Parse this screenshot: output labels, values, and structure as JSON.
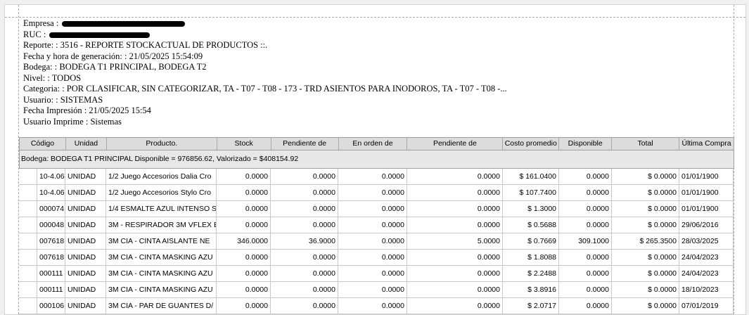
{
  "report": {
    "empresa_label": "Empresa :",
    "ruc_label": "RUC :",
    "reporte": "Reporte:  : 3516 - REPORTE STOCKACTUAL DE PRODUCTOS ::.",
    "fecha_generacion": "Fecha y hora de generación:  : 21/05/2025 15:54:09",
    "bodega": "Bodega:  : BODEGA T1  PRINCIPAL, BODEGA T2",
    "nivel": "Nivel:  : TODOS",
    "categoria": "Categoria:  : POR CLASIFICAR, SIN CATEGORIZAR, TA - T07 - T08 - 173 - TRD ASIENTOS PARA INODOROS, TA - T07 - T08 -...",
    "usuario": "Usuario:  : SISTEMAS",
    "fecha_impresion": "Fecha Impresión : 21/05/2025 15:54",
    "usuario_imprime": "Usuario Imprime : Sistemas"
  },
  "table": {
    "headers": [
      "Código",
      "Unidad",
      "Producto.",
      "Stock",
      "Pendiente de",
      "En orden de",
      "Pendiente de",
      "Costo promedio",
      "Disponible",
      "Total",
      "Última Compra"
    ],
    "group_label": "Bodega: BODEGA T1 PRINCIPAL Disponible = 976856.62, Valorizado = $408154.92",
    "rows": [
      [
        "10-4.06",
        "UNIDAD",
        "1/2 Juego Accesorios Dalia Cro",
        "0.0000",
        "0.0000",
        "0.0000",
        "0.0000",
        "$ 161.0400",
        "0.0000",
        "$ 0.0000",
        "01/01/1900"
      ],
      [
        "10-4.06",
        "UNIDAD",
        "1/2 Juego Accesorios Stylo Cro",
        "0.0000",
        "0.0000",
        "0.0000",
        "0.0000",
        "$ 107.7400",
        "0.0000",
        "$ 0.0000",
        "01/01/1900"
      ],
      [
        "000074",
        "UNIDAD",
        "1/4 ESMALTE AZUL INTENSO S",
        "0.0000",
        "0.0000",
        "0.0000",
        "0.0000",
        "$ 1.3000",
        "0.0000",
        "$ 0.0000",
        "01/01/1900"
      ],
      [
        "000048",
        "UNIDAD",
        "3M - RESPIRADOR 3M VFLEX E",
        "0.0000",
        "0.0000",
        "0.0000",
        "0.0000",
        "$ 0.5688",
        "0.0000",
        "$ 0.0000",
        "29/06/2016"
      ],
      [
        "007618",
        "UNIDAD",
        "3M CIA - CINTA AISLANTE NE",
        "346.0000",
        "36.9000",
        "0.0000",
        "5.0000",
        "$ 0.7669",
        "309.1000",
        "$ 265.3500",
        "28/03/2025"
      ],
      [
        "007618",
        "UNIDAD",
        "3M CIA - CINTA MASKING AZU",
        "0.0000",
        "0.0000",
        "0.0000",
        "0.0000",
        "$ 1.8088",
        "0.0000",
        "$ 0.0000",
        "24/04/2023"
      ],
      [
        "000111",
        "UNIDAD",
        "3M CIA - CINTA MASKING AZU",
        "0.0000",
        "0.0000",
        "0.0000",
        "0.0000",
        "$ 2.2488",
        "0.0000",
        "$ 0.0000",
        "24/04/2023"
      ],
      [
        "000111",
        "UNIDAD",
        "3M CIA - CINTA MASKING AZU",
        "0.0000",
        "0.0000",
        "0.0000",
        "0.0000",
        "$ 3.8916",
        "0.0000",
        "$ 0.0000",
        "18/10/2023"
      ],
      [
        "000106",
        "UNIDAD",
        "3M CIA - PAR DE GUANTES D/",
        "0.0000",
        "0.0000",
        "0.0000",
        "0.0000",
        "$ 2.0717",
        "0.0000",
        "$ 0.0000",
        "07/01/2019"
      ]
    ]
  }
}
